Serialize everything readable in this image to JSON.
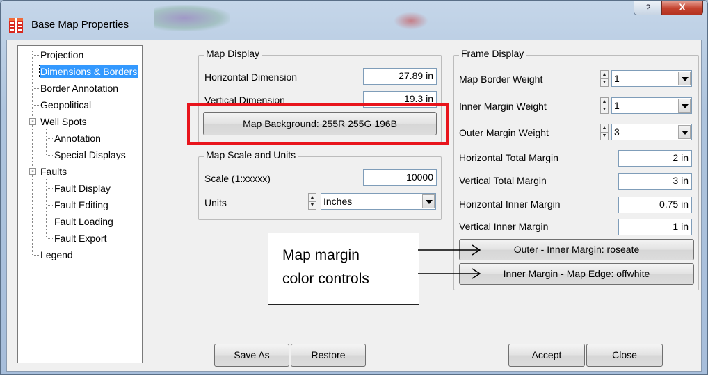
{
  "window": {
    "title": "Base Map Properties",
    "help_label": "?",
    "close_label": "X"
  },
  "tree": {
    "items": [
      {
        "label": "Projection"
      },
      {
        "label": "Dimensions & Borders"
      },
      {
        "label": "Border Annotation"
      },
      {
        "label": "Geopolitical"
      },
      {
        "label": "Well Spots",
        "expander": "-"
      },
      {
        "label": "Annotation"
      },
      {
        "label": "Special Displays"
      },
      {
        "label": "Faults",
        "expander": "-"
      },
      {
        "label": "Fault Display"
      },
      {
        "label": "Fault Editing"
      },
      {
        "label": "Fault Loading"
      },
      {
        "label": "Fault Export"
      },
      {
        "label": "Legend"
      }
    ],
    "selected": "Dimensions & Borders"
  },
  "map_display": {
    "title": "Map Display",
    "horizontal_label": "Horizontal Dimension",
    "horizontal_value": "27.89 in",
    "vertical_label": "Vertical Dimension",
    "vertical_value": "19.3 in",
    "background_button": "Map Background:  255R 255G 196B"
  },
  "scale_units": {
    "title": "Map Scale and Units",
    "scale_label": "Scale (1:xxxxx)",
    "scale_value": "10000",
    "units_label": "Units",
    "units_value": "Inches"
  },
  "frame_display": {
    "title": "Frame Display",
    "border_weight_label": "Map Border Weight",
    "border_weight_value": "1",
    "inner_weight_label": "Inner Margin Weight",
    "inner_weight_value": "1",
    "outer_weight_label": "Outer Margin Weight",
    "outer_weight_value": "3",
    "h_total_label": "Horizontal Total Margin",
    "h_total_value": "2 in",
    "v_total_label": "Vertical Total Margin",
    "v_total_value": "3 in",
    "h_inner_label": "Horizontal Inner Margin",
    "h_inner_value": "0.75 in",
    "v_inner_label": "Vertical Inner Margin",
    "v_inner_value": "1 in",
    "outer_inner_button": "Outer - Inner Margin:  roseate",
    "inner_edge_button": "Inner Margin - Map Edge:  offwhite"
  },
  "buttons": {
    "save_as": "Save As",
    "restore": "Restore",
    "accept": "Accept",
    "close": "Close"
  },
  "annotation": {
    "callout_line1": "Map margin",
    "callout_line2": "color controls",
    "highlight_color": "#e8141c"
  }
}
